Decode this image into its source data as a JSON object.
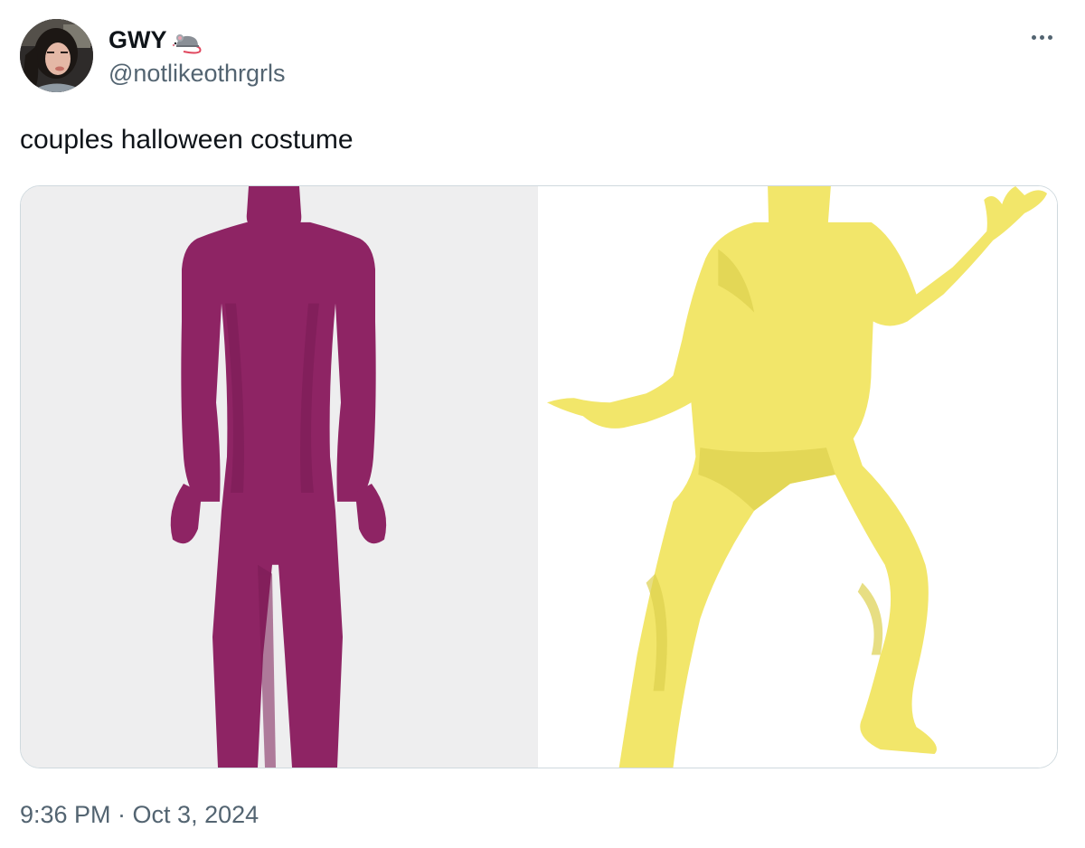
{
  "author": {
    "display_name": "GWY",
    "name_emoji_icon": "mouse-emoji-icon",
    "handle": "@notlikeothrgrls"
  },
  "tweet": {
    "text": "couples halloween costume",
    "timestamp": "9:36 PM · Oct 3, 2024"
  },
  "media": {
    "photos": [
      {
        "subject": "magenta full-body zentai suit",
        "suit_color": "#8e2464",
        "background": "#eeeeef"
      },
      {
        "subject": "yellow full-body zentai suit",
        "suit_color": "#f2e66a",
        "background": "#ffffff"
      }
    ]
  },
  "colors": {
    "text_primary": "#0f1419",
    "text_secondary": "#536471",
    "border": "#cfd9de"
  }
}
